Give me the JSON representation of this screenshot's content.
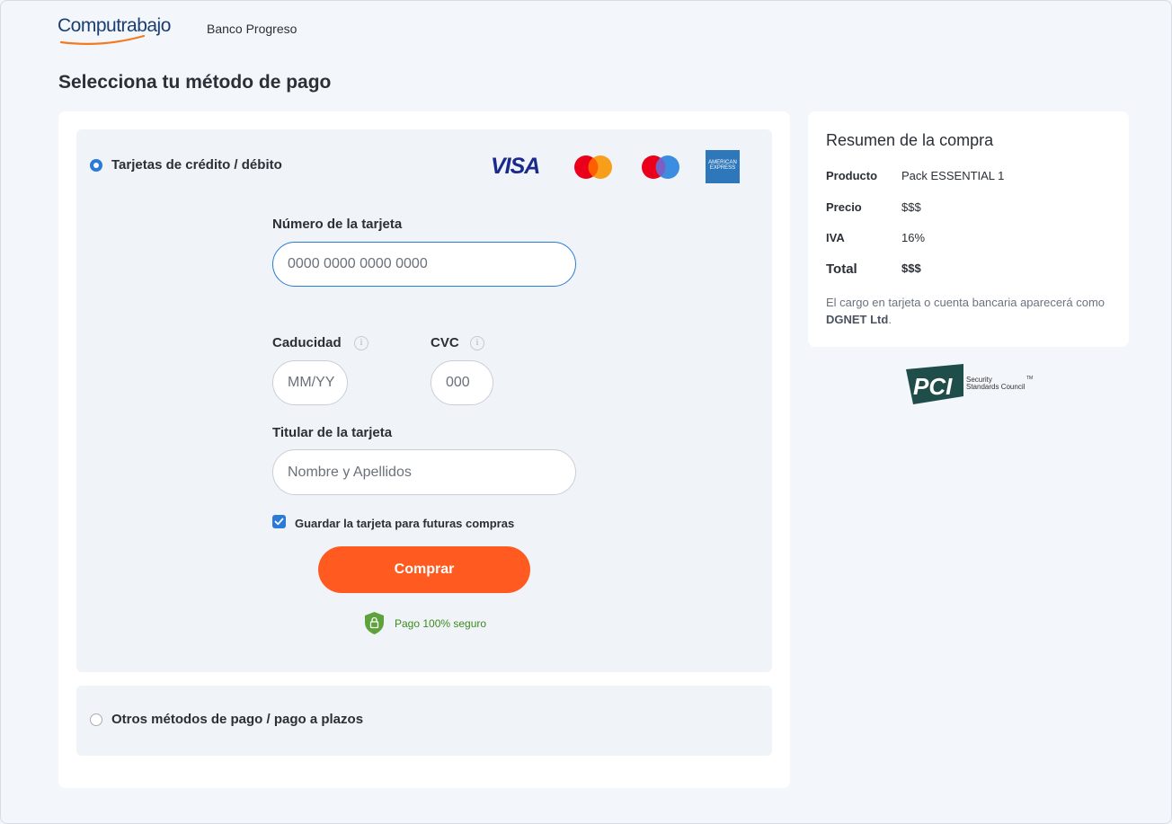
{
  "header": {
    "logo_text": "Computrabajo",
    "company_name": "Banco Progreso"
  },
  "page_title": "Selecciona tu método de pago",
  "payment": {
    "card_option": {
      "label": "Tarjetas de crédito / débito",
      "selected": true,
      "brands": [
        "VISA",
        "Mastercard",
        "Maestro",
        "American Express"
      ],
      "visa_text": "VISA",
      "amex_text": "AMERICAN EXPRESS"
    },
    "card_number": {
      "label": "Número de la tarjeta",
      "placeholder": "0000 0000 0000 0000",
      "value": ""
    },
    "expiry": {
      "label": "Caducidad",
      "placeholder": "MM/YY",
      "value": ""
    },
    "cvc": {
      "label": "CVC",
      "placeholder": "000",
      "value": ""
    },
    "holder": {
      "label": "Titular de la tarjeta",
      "placeholder": "Nombre y Apellidos",
      "value": ""
    },
    "save_card": {
      "label": "Guardar la tarjeta para futuras compras",
      "checked": true
    },
    "buy_button": "Comprar",
    "secure_text": "Pago 100% seguro",
    "other_option": {
      "label": "Otros métodos de pago / pago a plazos",
      "selected": false
    }
  },
  "summary": {
    "title": "Resumen de la compra",
    "rows": [
      {
        "key": "Producto",
        "value": "Pack ESSENTIAL 1"
      },
      {
        "key": "Precio",
        "value": "$$$"
      },
      {
        "key": "IVA",
        "value": "16%"
      },
      {
        "key": "Total",
        "value": "$$$"
      }
    ],
    "note_prefix": "El cargo en tarjeta o cuenta bancaria aparecerá como ",
    "note_company": "DGNET Ltd",
    "note_suffix": "."
  },
  "pci": {
    "logo_text": "PCI",
    "line1": "Security",
    "line2": "Standards Council",
    "tm": "TM"
  },
  "colors": {
    "accent": "#2a7ad8",
    "buy_button": "#ff5a1f",
    "secure_green": "#3e8a1e",
    "brand_navy": "#1c3d73"
  },
  "icons": {
    "info": "info-icon",
    "secure": "shield-lock-icon",
    "check": "check-icon"
  }
}
